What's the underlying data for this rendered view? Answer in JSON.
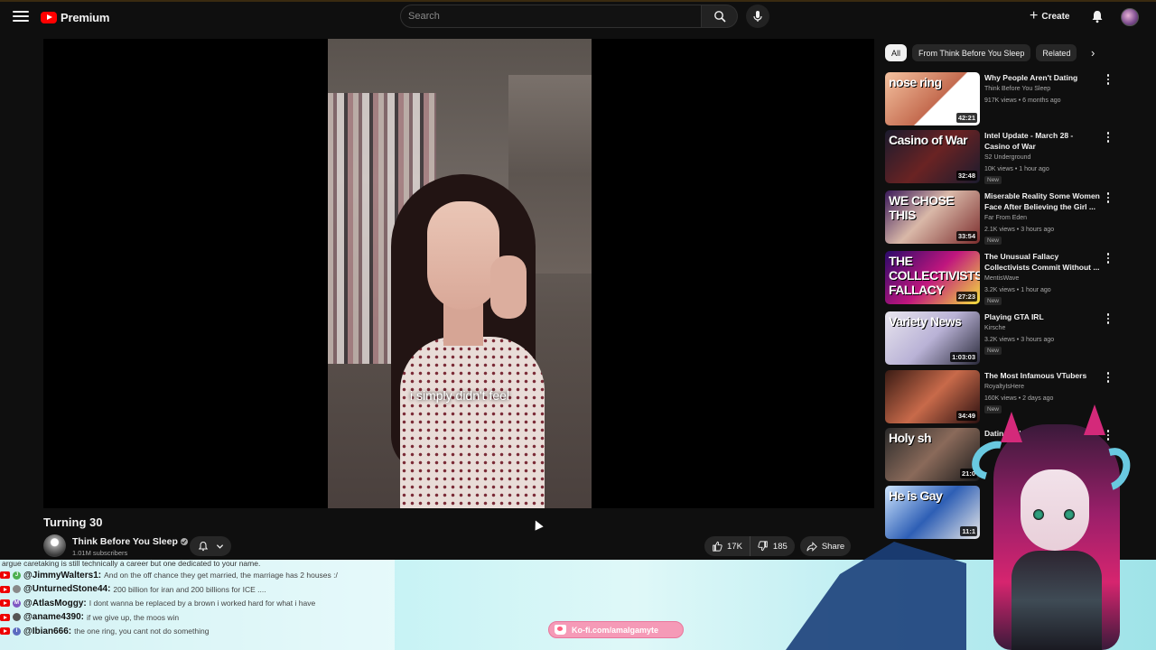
{
  "header": {
    "logo_text": "Premium",
    "search_placeholder": "Search",
    "create_label": "Create"
  },
  "video": {
    "subtitle": "i simply didn't feel",
    "title": "Turning 30",
    "channel": "Think Before You Sleep",
    "subscribers": "1.01M subscribers",
    "likes": "17K",
    "dislikes": "185",
    "share_label": "Share"
  },
  "sidebar": {
    "chips": [
      "All",
      "From Think Before You Sleep",
      "Related"
    ],
    "items": [
      {
        "title": "Why People Aren't Dating",
        "channel": "Think Before You Sleep",
        "meta": "917K views • 6 months ago",
        "duration": "42:21",
        "badge": "",
        "thumb_text": "nose ring"
      },
      {
        "title": "Intel Update - March 28 - Casino of War",
        "channel": "S2 Underground",
        "meta": "10K views • 1 hour ago",
        "duration": "32:48",
        "badge": "New",
        "thumb_text": "Casino of War"
      },
      {
        "title": "Miserable Reality Some Women Face After Believing the Girl ...",
        "channel": "Far From Eden",
        "meta": "2.1K views • 3 hours ago",
        "duration": "33:54",
        "badge": "New",
        "thumb_text": "WE CHOSE THIS"
      },
      {
        "title": "The Unusual Fallacy Collectivists Commit Without ...",
        "channel": "MentisWave",
        "meta": "3.2K views • 1 hour ago",
        "duration": "27:23",
        "badge": "New",
        "thumb_text": "THE COLLECTIVISTS FALLACY"
      },
      {
        "title": "Playing GTA IRL",
        "channel": "Kirsche",
        "meta": "3.2K views • 3 hours ago",
        "duration": "1:03:03",
        "badge": "New",
        "thumb_text": "Variety News"
      },
      {
        "title": "The Most Infamous VTubers",
        "channel": "RoyaltyIsHere",
        "meta": "160K views • 2 days ago",
        "duration": "34:49",
        "badge": "New",
        "thumb_text": ""
      },
      {
        "title": "Dating ... broke everyth",
        "channel": "",
        "meta": "",
        "duration": "21:0",
        "badge": "",
        "thumb_text": "Holy sh"
      },
      {
        "title": "",
        "channel": "",
        "meta": "",
        "duration": "11:1",
        "badge": "",
        "thumb_text": "He is Gay"
      }
    ]
  },
  "chat": {
    "first_line": "argue caretaking is still technically a career but one dedicated to your name.",
    "messages": [
      {
        "initial": "J",
        "color": "#4caf50",
        "user": "@JimmyWalters1:",
        "text": "And on the off chance they get married, the marriage has 2 houses :/"
      },
      {
        "initial": "",
        "color": "#888888",
        "user": "@UnturnedStone44:",
        "text": "200 billion for iran and 200 billions for ICE ...."
      },
      {
        "initial": "M",
        "color": "#7e57c2",
        "user": "@AtlasMoggy:",
        "text": "I dont wanna be replaced by a brown i worked hard for what i have"
      },
      {
        "initial": "",
        "color": "#555555",
        "user": "@aname4390:",
        "text": "if we give up, the moos win"
      },
      {
        "initial": "I",
        "color": "#5c6bc0",
        "user": "@Ibian666:",
        "text": "the one ring, you cant not do something"
      }
    ]
  },
  "overlay": {
    "kofi": "Ko-fi.com/amalgamyte"
  },
  "colors": {
    "background": "#0f0f0f",
    "accent_red": "#ff0000",
    "chip_bg": "#272727",
    "band": "#c8f3f5",
    "kofi": "#f59ab7"
  }
}
